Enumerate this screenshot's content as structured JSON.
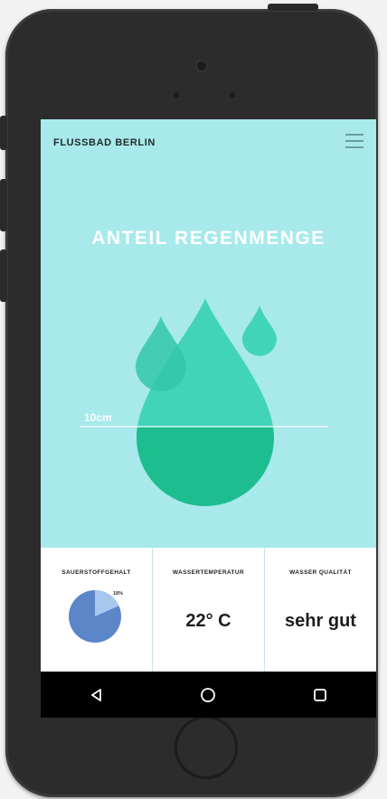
{
  "app": {
    "title": "FLUSSBAD BERLIN",
    "hero_title": "ANTEIL REGENMENGE",
    "level_label": "10cm"
  },
  "stats": [
    {
      "label": "SAUERSTOFFGEHALT",
      "percent": "18%",
      "percent_value": 18
    },
    {
      "label": "WASSERTEMPERATUR",
      "value": "22° C"
    },
    {
      "label": "WASSER QUALITÄT",
      "value": "sehr gut"
    }
  ],
  "colors": {
    "background": "#a8e9ec",
    "drop": "#35d1b6",
    "drop_fill": "#1ebd8f",
    "pie": "#5b86c7",
    "pie_highlight": "#a9c6ef"
  },
  "icons": {
    "menu": "hamburger-icon",
    "nav": [
      "back-icon",
      "home-icon",
      "recents-icon"
    ]
  }
}
